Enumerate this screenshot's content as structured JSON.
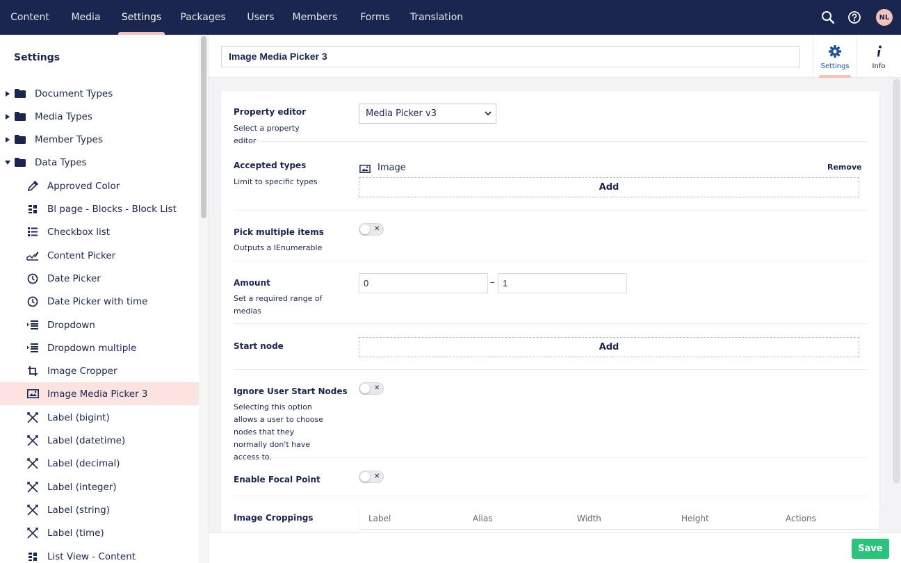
{
  "topnav": {
    "items": [
      "Content",
      "Media",
      "Settings",
      "Packages",
      "Users",
      "Members",
      "Forms",
      "Translation"
    ],
    "active": "Settings",
    "avatar_initials": "NL"
  },
  "sidebar": {
    "title": "Settings",
    "sections": [
      {
        "label": "Document Types",
        "expanded": false
      },
      {
        "label": "Media Types",
        "expanded": false
      },
      {
        "label": "Member Types",
        "expanded": false
      },
      {
        "label": "Data Types",
        "expanded": true
      }
    ],
    "items": [
      {
        "label": "Approved Color",
        "icon": "eyedropper-icon"
      },
      {
        "label": "Bl page - Blocks - Block List",
        "icon": "block-list-icon"
      },
      {
        "label": "Checkbox list",
        "icon": "checkbox-list-icon"
      },
      {
        "label": "Content Picker",
        "icon": "content-picker-icon"
      },
      {
        "label": "Date Picker",
        "icon": "clock-icon"
      },
      {
        "label": "Date Picker with time",
        "icon": "clock-icon"
      },
      {
        "label": "Dropdown",
        "icon": "dropdown-list-icon"
      },
      {
        "label": "Dropdown multiple",
        "icon": "dropdown-list-icon"
      },
      {
        "label": "Image Cropper",
        "icon": "crop-icon"
      },
      {
        "label": "Image Media Picker 3",
        "icon": "picture-icon"
      },
      {
        "label": "Label (bigint)",
        "icon": "label-icon"
      },
      {
        "label": "Label (datetime)",
        "icon": "label-icon"
      },
      {
        "label": "Label (decimal)",
        "icon": "label-icon"
      },
      {
        "label": "Label (integer)",
        "icon": "label-icon"
      },
      {
        "label": "Label (string)",
        "icon": "label-icon"
      },
      {
        "label": "Label (time)",
        "icon": "label-icon"
      },
      {
        "label": "List View - Content",
        "icon": "grid-icon"
      }
    ],
    "selected": "Image Media Picker 3"
  },
  "editor": {
    "name": "Image Media Picker 3",
    "apps": [
      {
        "label": "Settings",
        "icon": "gear-icon",
        "active": true
      },
      {
        "label": "Info",
        "icon": "info-icon",
        "active": false
      }
    ],
    "properties": {
      "property_editor": {
        "label": "Property editor",
        "desc": "Select a property editor",
        "value": "Media Picker v3"
      },
      "accepted_types": {
        "label": "Accepted types",
        "desc": "Limit to specific types",
        "type_name": "Image",
        "remove_label": "Remove",
        "add_label": "Add"
      },
      "pick_multiple": {
        "label": "Pick multiple items",
        "desc": "Outputs a IEnumerable",
        "checked": false
      },
      "amount": {
        "label": "Amount",
        "desc": "Set a required range of medias",
        "min": "0",
        "separator": "–",
        "max": "1"
      },
      "start_node": {
        "label": "Start node",
        "add_label": "Add"
      },
      "ignore_start_nodes": {
        "label": "Ignore User Start Nodes",
        "desc": "Selecting this option allows a user to choose nodes that they normally don't have access to.",
        "checked": false
      },
      "focal_point": {
        "label": "Enable Focal Point",
        "checked": false
      },
      "croppings": {
        "label": "Image Croppings",
        "columns": [
          "Label",
          "Alias",
          "Width",
          "Height",
          "Actions"
        ]
      }
    },
    "save_label": "Save"
  },
  "colors": {
    "topbar": "#1b264f",
    "accent": "#f5c1bc",
    "selected_row": "#fbe3e1",
    "save": "#2bc37c",
    "link": "#2152a3"
  }
}
